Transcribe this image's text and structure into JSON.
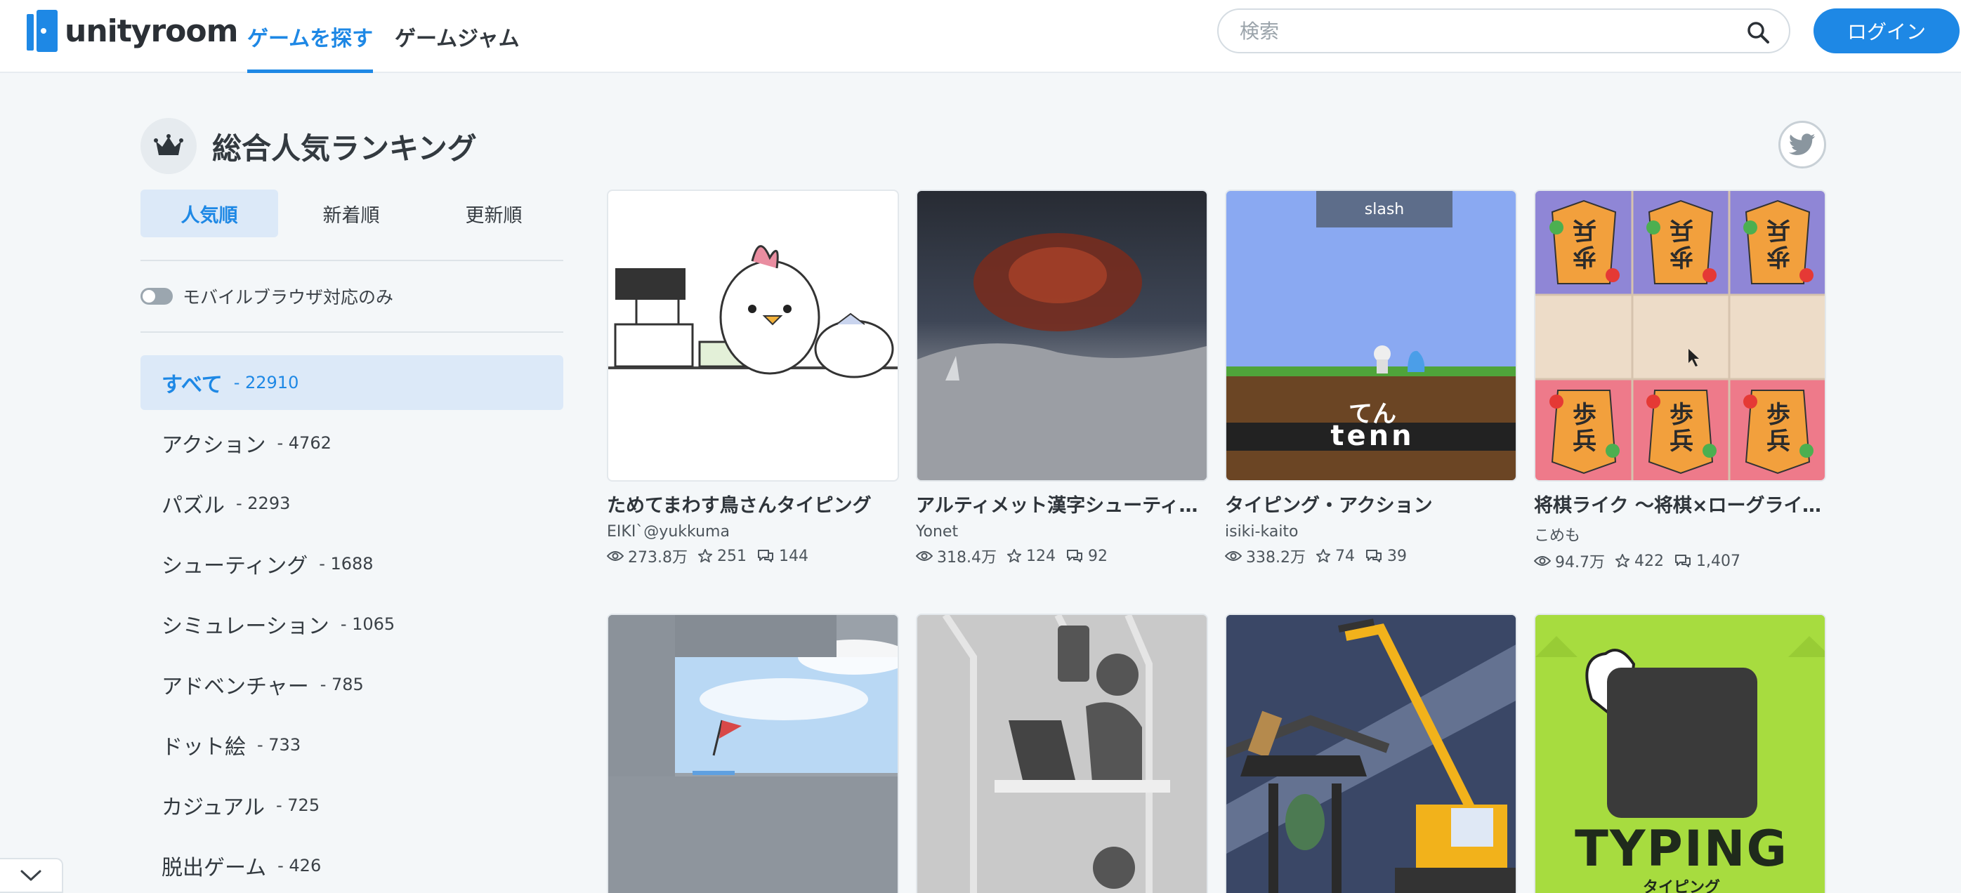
{
  "header": {
    "logo_text": "unityroom",
    "nav": [
      "ゲームを探す",
      "ゲームジャム"
    ],
    "search_placeholder": "検索",
    "login_label": "ログイン"
  },
  "page": {
    "title": "総合人気ランキング"
  },
  "sidebar": {
    "sort_tabs": [
      "人気順",
      "新着順",
      "更新順"
    ],
    "mobile_toggle_label": "モバイルブラウザ対応のみ",
    "categories": [
      {
        "label": "すべて",
        "count": "- 22910"
      },
      {
        "label": "アクション",
        "count": "- 4762"
      },
      {
        "label": "パズル",
        "count": "- 2293"
      },
      {
        "label": "シューティング",
        "count": "- 1688"
      },
      {
        "label": "シミュレーション",
        "count": "- 1065"
      },
      {
        "label": "アドベンチャー",
        "count": "- 785"
      },
      {
        "label": "ドット絵",
        "count": "- 733"
      },
      {
        "label": "カジュアル",
        "count": "- 725"
      },
      {
        "label": "脱出ゲーム",
        "count": "- 426"
      }
    ]
  },
  "games": [
    {
      "title": "ためてまわす鳥さんタイピング",
      "author": "EIKI`@yukkuma",
      "views": "273.8万",
      "stars": "251",
      "comments": "144"
    },
    {
      "title": "アルティメット漢字シューティング",
      "author": "Yonet",
      "views": "318.4万",
      "stars": "124",
      "comments": "92"
    },
    {
      "title": "タイピング・アクション",
      "author": "isiki-kaito",
      "views": "338.2万",
      "stars": "74",
      "comments": "39",
      "thumb_top_text": "slash",
      "thumb_kana": "てん",
      "thumb_roman": "tenn"
    },
    {
      "title": "将棋ライク 〜将棋×ローグライク〜",
      "author": "こめも",
      "views": "94.7万",
      "stars": "422",
      "comments": "1,407",
      "thumb_piece_text": "歩兵"
    },
    {
      "title": "",
      "author": "",
      "views": "",
      "stars": "",
      "comments": ""
    },
    {
      "title": "",
      "author": "",
      "views": "",
      "stars": "",
      "comments": ""
    },
    {
      "title": "",
      "author": "",
      "views": "",
      "stars": "",
      "comments": ""
    },
    {
      "title": "",
      "author": "",
      "views": "",
      "stars": "",
      "comments": "",
      "thumb_word": "TYPING",
      "thumb_sub": "タイピング"
    }
  ]
}
